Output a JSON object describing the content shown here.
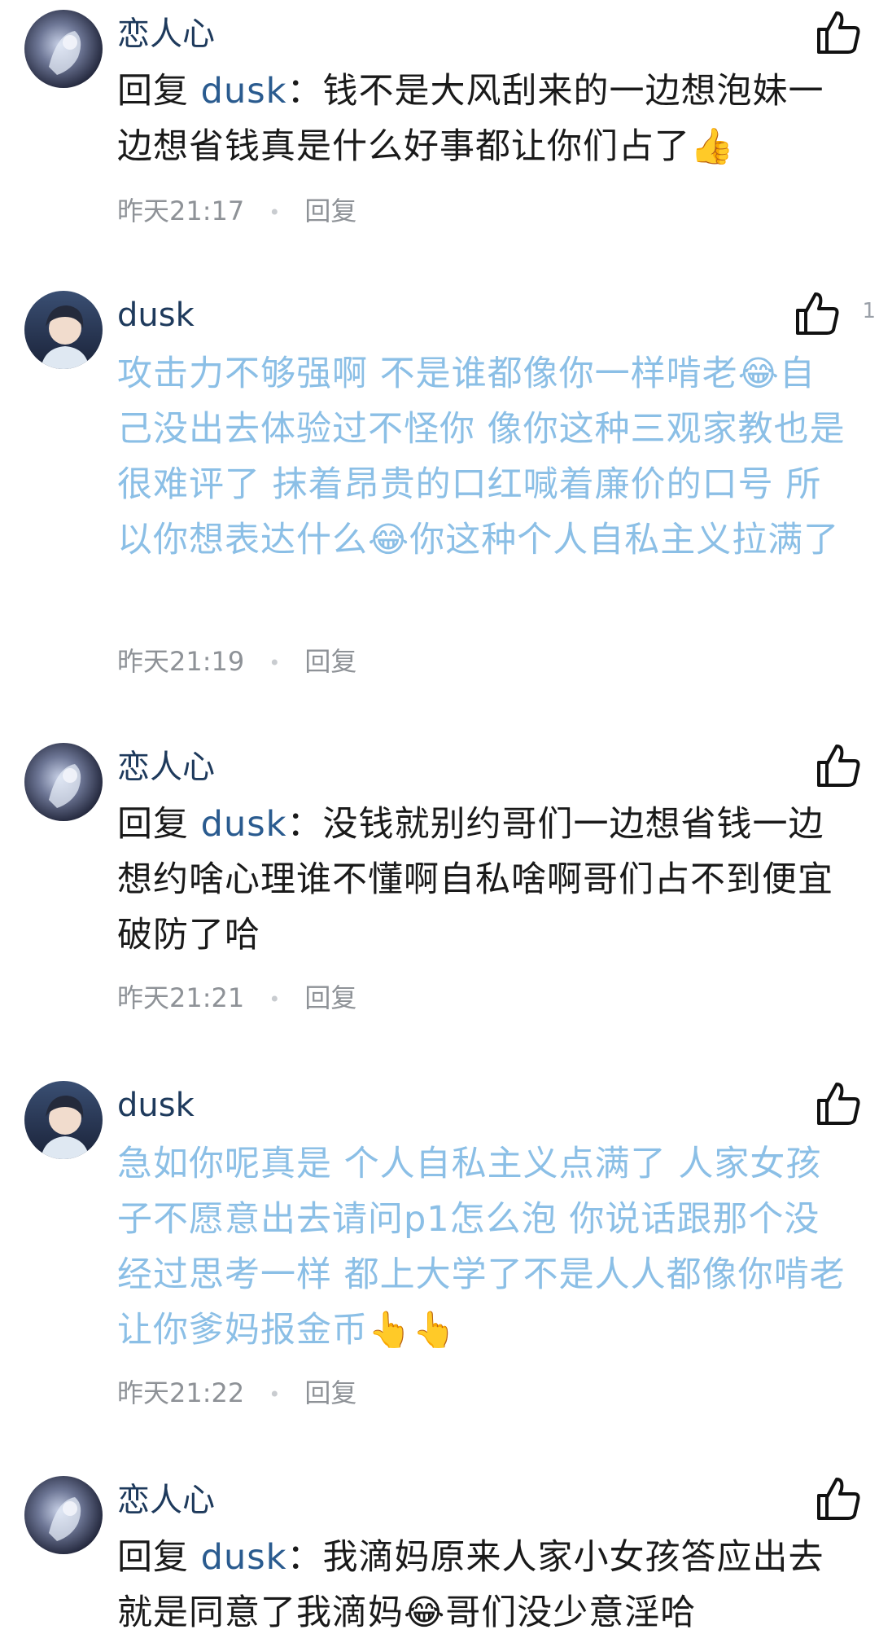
{
  "comments": [
    {
      "user": "恋人心",
      "avatar": "avatar-lianrenxin",
      "is_reply": true,
      "reply_prefix": "回复",
      "reply_to": "dusk",
      "text": "：钱不是大风刮来的一边想泡妹一边想省钱真是什么好事都让你们占了👍",
      "time": "昨天21:17",
      "reply_label": "回复",
      "like_count": ""
    },
    {
      "user": "dusk",
      "avatar": "avatar-dusk",
      "is_reply": false,
      "text": "攻击力不够强啊 不是谁都像你一样啃老😂自己没出去体验过不怪你 像你这种三观家教也是很难评了 抹着昂贵的口红喊着廉价的口号 所以你想表达什么😂你这种个人自私主义拉满了",
      "time": "昨天21:19",
      "reply_label": "回复",
      "like_count": "1"
    },
    {
      "user": "恋人心",
      "avatar": "avatar-lianrenxin",
      "is_reply": true,
      "reply_prefix": "回复",
      "reply_to": "dusk",
      "text": "：没钱就别约哥们一边想省钱一边想约啥心理谁不懂啊自私啥啊哥们占不到便宜破防了哈",
      "time": "昨天21:21",
      "reply_label": "回复",
      "like_count": ""
    },
    {
      "user": "dusk",
      "avatar": "avatar-dusk",
      "is_reply": false,
      "text": "急如你呢真是 个人自私主义点满了 人家女孩子不愿意出去请问p1怎么泡 你说话跟那个没经过思考一样 都上大学了不是人人都像你啃老让你爹妈报金币👆👆",
      "time": "昨天21:22",
      "reply_label": "回复",
      "like_count": ""
    },
    {
      "user": "恋人心",
      "avatar": "avatar-lianrenxin",
      "is_reply": true,
      "reply_prefix": "回复",
      "reply_to": "dusk",
      "text": "：我滴妈原来人家小女孩答应出去就是同意了我滴妈😂哥们没少意淫哈",
      "time": "",
      "reply_label": "",
      "like_count": ""
    }
  ],
  "colors": {
    "name": "#1e3a5c",
    "reply_text": "#1a1a1a",
    "reply_target": "#2a5b8f",
    "blue_text": "#8bbfe6",
    "meta": "#8e9297"
  }
}
